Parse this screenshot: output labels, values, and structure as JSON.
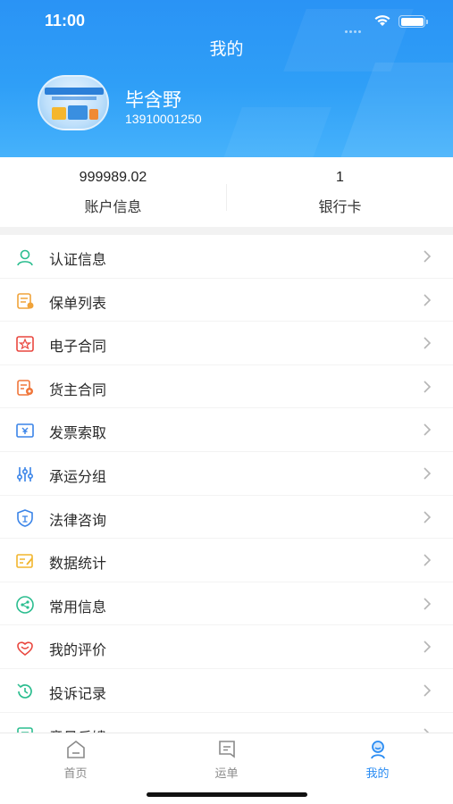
{
  "status_bar": {
    "time": "11:00"
  },
  "header": {
    "title": "我的"
  },
  "user": {
    "name": "毕含野",
    "phone": "13910001250"
  },
  "stats": [
    {
      "value": "999989.02",
      "label": "账户信息"
    },
    {
      "value": "1",
      "label": "银行卡"
    }
  ],
  "menu": [
    {
      "label": "认证信息",
      "icon": "user-icon",
      "color": "#2bbd8f"
    },
    {
      "label": "保单列表",
      "icon": "policy-icon",
      "color": "#f0a33a"
    },
    {
      "label": "电子合同",
      "icon": "contract-icon",
      "color": "#e9473f"
    },
    {
      "label": "货主合同",
      "icon": "shipper-contract-icon",
      "color": "#f0763a"
    },
    {
      "label": "发票索取",
      "icon": "invoice-icon",
      "color": "#3a84e8"
    },
    {
      "label": "承运分组",
      "icon": "sliders-icon",
      "color": "#3a84e8"
    },
    {
      "label": "法律咨询",
      "icon": "law-shield-icon",
      "color": "#3a84e8"
    },
    {
      "label": "数据统计",
      "icon": "stats-icon",
      "color": "#f2b52d"
    },
    {
      "label": "常用信息",
      "icon": "share-icon",
      "color": "#2bbd8f"
    },
    {
      "label": "我的评价",
      "icon": "rating-icon",
      "color": "#e9473f"
    },
    {
      "label": "投诉记录",
      "icon": "history-icon",
      "color": "#2bbd8f"
    },
    {
      "label": "意见反馈",
      "icon": "feedback-icon",
      "color": "#2bbd8f"
    }
  ],
  "tabbar": [
    {
      "label": "首页",
      "icon": "home-icon",
      "active": false
    },
    {
      "label": "运单",
      "icon": "waybill-icon",
      "active": false
    },
    {
      "label": "我的",
      "icon": "profile-icon",
      "active": true
    }
  ],
  "colors": {
    "primary": "#2a8cf3",
    "header_start": "#2a93f5",
    "header_end": "#46b2fb"
  }
}
